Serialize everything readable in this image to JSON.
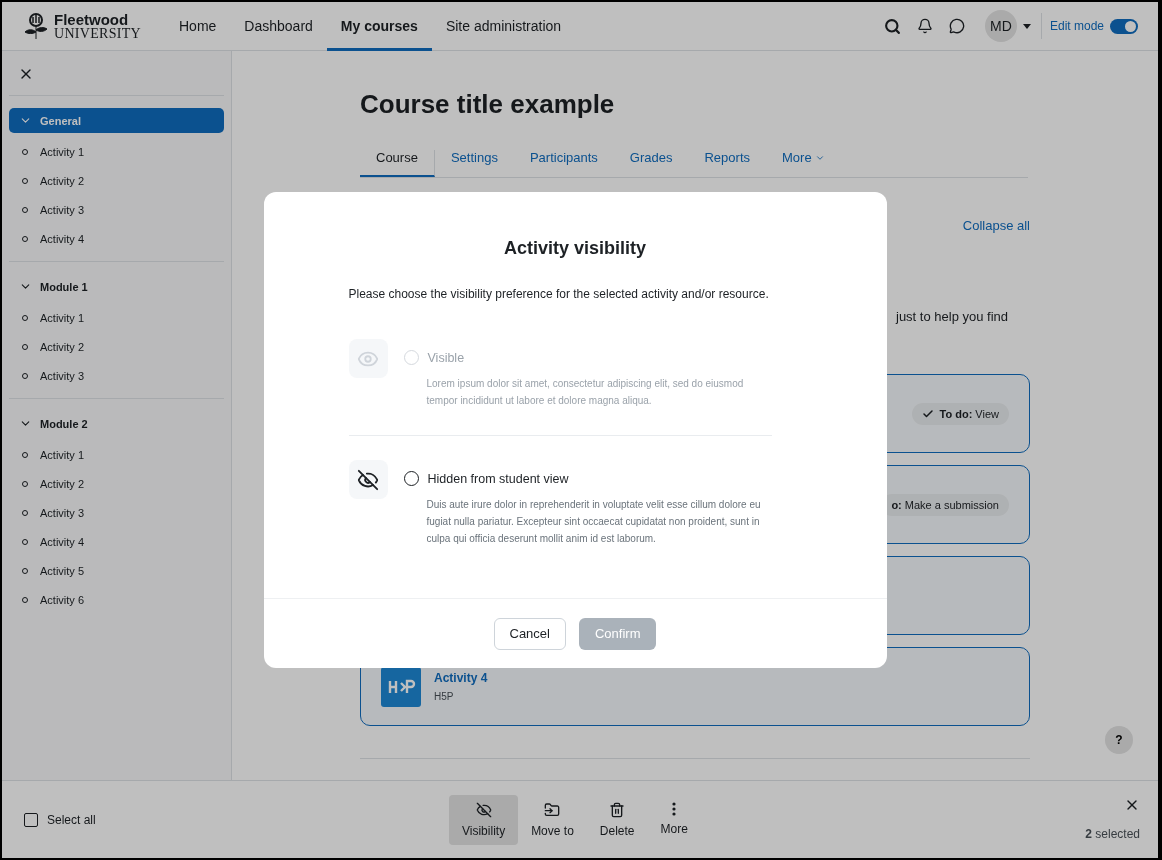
{
  "navbar": {
    "logo": {
      "name": "Fleetwood",
      "sub": "UNIVERSITY"
    },
    "items": [
      {
        "label": "Home",
        "selected": false
      },
      {
        "label": "Dashboard",
        "selected": false
      },
      {
        "label": "My courses",
        "selected": true
      },
      {
        "label": "Site administration",
        "selected": false
      }
    ],
    "user_initials": "MD",
    "edit_mode": {
      "label": "Edit mode",
      "on": true
    }
  },
  "sidebar": {
    "sections": [
      {
        "title": "General",
        "selected": true,
        "expanded": true,
        "items": [
          "Activity 1",
          "Activity 2",
          "Activity 3",
          "Activity 4"
        ]
      },
      {
        "title": "Module 1",
        "selected": false,
        "expanded": true,
        "items": [
          "Activity 1",
          "Activity 2",
          "Activity 3"
        ]
      },
      {
        "title": "Module 2",
        "selected": false,
        "expanded": true,
        "items": [
          "Activity 1",
          "Activity 2",
          "Activity 3",
          "Activity 4",
          "Activity 5",
          "Activity 6"
        ]
      }
    ]
  },
  "course": {
    "title": "Course title example",
    "tabs": [
      {
        "label": "Course",
        "selected": true,
        "kind": "plain"
      },
      {
        "label": "Settings",
        "selected": false,
        "kind": "plain"
      },
      {
        "label": "Participants",
        "selected": false,
        "kind": "plain"
      },
      {
        "label": "Grades",
        "selected": false,
        "kind": "plain"
      },
      {
        "label": "Reports",
        "selected": false,
        "kind": "plain"
      },
      {
        "label": "More",
        "selected": false,
        "kind": "menu"
      }
    ],
    "collapse_all": "Collapse all",
    "intro_fragment": "just to help you find",
    "activities": [
      {
        "kind": "plain",
        "badge": "**To do:** View"
      },
      {
        "kind": "plain",
        "badge": "**o:** Make a submission"
      },
      {
        "kind": "plain"
      },
      {
        "title": "Activity 4",
        "type": "H5P",
        "kind": "h5p"
      }
    ],
    "help": "?"
  },
  "modal": {
    "title": "Activity visibility",
    "description": "Please choose the visibility preference for the selected activity and/or resource.",
    "options": [
      {
        "kind": "visible",
        "label": "Visible",
        "description": "Lorem ipsum dolor sit amet, consectetur adipiscing elit, sed do eiusmod tempor incididunt ut labore et dolore magna aliqua.",
        "disabled": true,
        "selected": false
      },
      {
        "kind": "hidden",
        "label": "Hidden from student view",
        "description": "Duis aute irure dolor in reprehenderit in voluptate velit esse cillum dolore eu fugiat nulla pariatur. Excepteur sint occaecat cupidatat non proident, sunt in culpa qui officia deserunt mollit anim id est laborum.",
        "disabled": false,
        "selected": false
      }
    ],
    "buttons": [
      {
        "label": "Cancel",
        "kind": "secondary"
      },
      {
        "label": "Confirm",
        "kind": "primary",
        "disabled": true
      }
    ]
  },
  "bulk_bar": {
    "select_all": {
      "label": "Select all",
      "checked": false
    },
    "actions": [
      {
        "label": "Visibility",
        "kind": "visibility",
        "selected": true
      },
      {
        "label": "Move to",
        "kind": "move",
        "selected": false
      },
      {
        "label": "Delete",
        "kind": "delete",
        "selected": false
      },
      {
        "label": "More",
        "kind": "more",
        "selected": false
      }
    ],
    "selected_count": "**2** selected"
  }
}
